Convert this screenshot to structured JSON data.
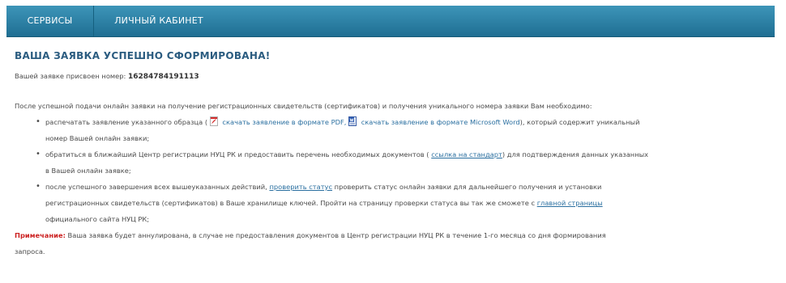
{
  "nav": {
    "tabs": [
      {
        "label": "Сервисы"
      },
      {
        "label": "Личный кабинет"
      }
    ]
  },
  "main": {
    "title": "ВАША ЗАЯВКА УСПЕШНО СФОРМИРОВАНА!",
    "number_prefix": "Вашей заявке присвоен номер:",
    "request_number": "16284784191113",
    "intro": "После успешной подачи онлайн заявки на получение регистрационных свидетельств (сертификатов) и получения уникального номера заявки Вам необходимо:",
    "step1": {
      "text_a": "распечатать заявление указанного образца (",
      "pdf_link": "скачать заявление в формате PDF,",
      "word_link": "скачать заявление в формате Microsoft Word",
      "text_b": "), который содержит уникальный",
      "text_c": "номер Вашей онлайн заявки;"
    },
    "step2": {
      "text_a": "обратиться в ближайший Центр регистрации НУЦ РК и предоставить перечень необходимых документов (",
      "std_link": "ссылка на стандарт",
      "text_b": ") для подтверждения данных указанных",
      "text_c": "в Вашей онлайн заявке;"
    },
    "step3": {
      "text_a": "после успешного завершения всех вышеуказанных действий,",
      "status_link": "проверить статус",
      "text_b": "проверить статус онлайн заявки для дальнейшего получения и установки",
      "text_c": "регистрационных свидетельств (сертификатов) в Ваше хранилище ключей. Пройти на страницу проверки статуса вы так же сможете с",
      "home_link": "главной страницы",
      "text_d": "официального сайта НУЦ РК;"
    },
    "note": {
      "label": "Примечание:",
      "text": "Ваша заявка будет аннулирована, в случае не предоставления документов в Центр регистрации НУЦ РК в течение 1-го месяца со дня формирования",
      "text_cont": "запроса."
    }
  },
  "icons": {
    "pdf": "pdf-file-icon",
    "word": "word-file-icon"
  },
  "colors": {
    "nav_bar": "#2a81a6",
    "title": "#2b5c80",
    "link": "#2a6fa0",
    "note_label": "#cc2222"
  }
}
